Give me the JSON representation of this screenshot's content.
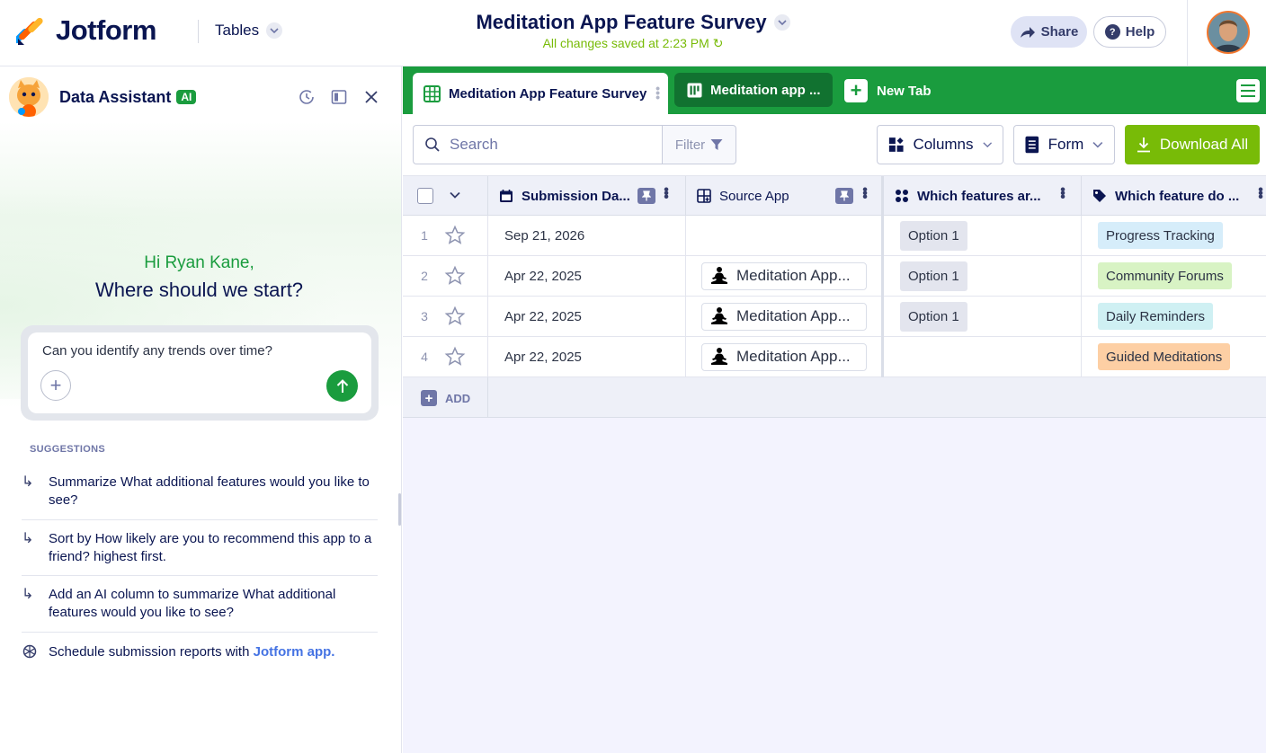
{
  "header": {
    "logo_text": "Jotform",
    "tables_label": "Tables",
    "app_title": "Meditation App Feature Survey",
    "saved_status": "All changes saved at 2:23 PM",
    "share_label": "Share",
    "help_label": "Help"
  },
  "assistant": {
    "title": "Data Assistant",
    "ai_badge": "AI",
    "greeting_name": "Hi Ryan Kane,",
    "greeting_question": "Where should we start?",
    "prompt_text": "Can you identify any trends over time?",
    "suggestions_heading": "SUGGESTIONS",
    "suggestions": [
      "Summarize What additional features would you like to see?",
      "Sort by How likely are you to recommend this app to a friend? highest first.",
      "Add an AI column to summarize What additional features would you like to see?"
    ],
    "schedule_text": "Schedule submission reports with ",
    "schedule_link": "Jotform app."
  },
  "tabs": {
    "tab1_label": "Meditation App Feature Survey",
    "tab2_label": "Meditation app ...",
    "new_tab_label": "New Tab"
  },
  "toolbar": {
    "search_placeholder": "Search",
    "filter_label": "Filter",
    "columns_label": "Columns",
    "form_label": "Form",
    "download_label": "Download All"
  },
  "table": {
    "columns": [
      "Submission Da...",
      "Source App",
      "Which features ar...",
      "Which feature do ..."
    ],
    "rows": [
      {
        "num": "1",
        "date": "Sep 21, 2026",
        "app": "",
        "option": "Option 1",
        "feature": "Progress Tracking"
      },
      {
        "num": "2",
        "date": "Apr 22, 2025",
        "app": "Meditation App...",
        "option": "Option 1",
        "feature": "Community Forums"
      },
      {
        "num": "3",
        "date": "Apr 22, 2025",
        "app": "Meditation App...",
        "option": "Option 1",
        "feature": "Daily Reminders"
      },
      {
        "num": "4",
        "date": "Apr 22, 2025",
        "app": "Meditation App...",
        "option": "",
        "feature": "Guided Meditations"
      }
    ],
    "add_label": "ADD"
  },
  "colors": {
    "brand_green": "#1a9c3e",
    "download_green": "#78bb07",
    "tag_progress": "#d6edfa",
    "tag_community": "#d8f3c4",
    "tag_reminders": "#cff0f3",
    "tag_guided": "#fdcfa4"
  }
}
